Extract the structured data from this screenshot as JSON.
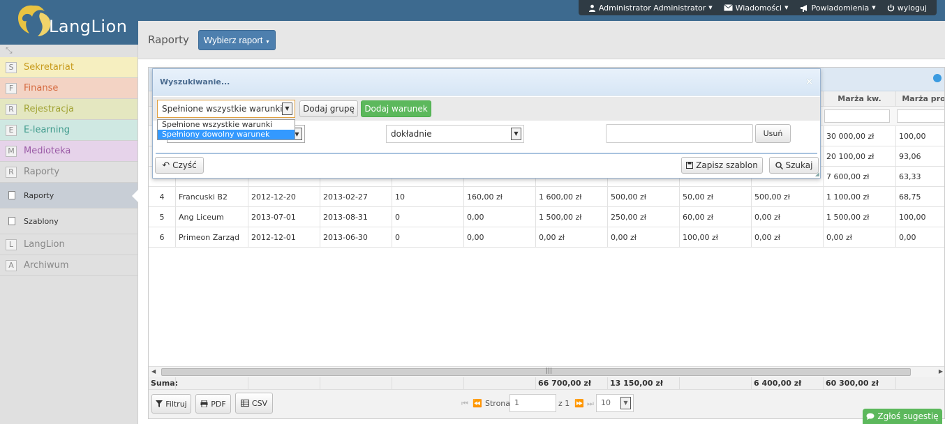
{
  "app": {
    "logo_text": "LangLion"
  },
  "top_menu": [
    {
      "label": "Administrator Administrator",
      "icon": "user-icon",
      "caret": true
    },
    {
      "label": "Wiadomości",
      "icon": "envelope-icon",
      "caret": true
    },
    {
      "label": "Powiadomienia",
      "icon": "megaphone-icon",
      "caret": true
    },
    {
      "label": "wyloguj",
      "icon": "power-icon",
      "caret": false
    }
  ],
  "sidebar": {
    "items": [
      {
        "letter": "S",
        "label": "Sekretariat",
        "color": "#f6efc0",
        "text": "#c79a1b"
      },
      {
        "letter": "F",
        "label": "Finanse",
        "color": "#f3d3c4",
        "text": "#d66c42"
      },
      {
        "letter": "R",
        "label": "Rejestracja",
        "color": "#e4e7c0",
        "text": "#a2a436"
      },
      {
        "letter": "E",
        "label": "E-learning",
        "color": "#cfe8e2",
        "text": "#3f9a8c"
      },
      {
        "letter": "M",
        "label": "Medioteka",
        "color": "#e6d3ea",
        "text": "#9a5aa6"
      },
      {
        "letter": "R",
        "label": "Raporty",
        "color": "#e0e0e0",
        "text": "#888888"
      }
    ],
    "sub_items": [
      {
        "label": "Raporty",
        "active": true
      },
      {
        "label": "Szablony",
        "active": false
      }
    ],
    "bottom_items": [
      {
        "letter": "L",
        "label": "LangLion"
      },
      {
        "letter": "A",
        "label": "Archiwum"
      }
    ]
  },
  "header": {
    "title": "Raporty",
    "select_report_label": "Wybierz raport"
  },
  "table": {
    "headers": [
      "Marża kw.",
      "Marża pro"
    ],
    "rows": [
      {
        "no": "",
        "name": "",
        "start": "",
        "end": "",
        "c5": "",
        "c6": "",
        "c7": "",
        "c8": "",
        "c9": "",
        "c10": "",
        "c11": "30 000,00 zł",
        "c12": "100,00"
      },
      {
        "no": "",
        "name": "",
        "start": "",
        "end": "",
        "c5": "",
        "c6": "",
        "c7": "",
        "c8": "",
        "c9": "",
        "c10": "",
        "c11": "20 100,00 zł",
        "c12": "93,06"
      },
      {
        "no": "",
        "name": "",
        "start": "",
        "end": "",
        "c5": "",
        "c6": "",
        "c7": "",
        "c8": "",
        "c9": "",
        "c10": "",
        "c11": "7 600,00 zł",
        "c12": "63,33"
      },
      {
        "no": "4",
        "name": "Francuski B2",
        "start": "2012-12-20",
        "end": "2013-02-27",
        "c5": "10",
        "c6": "160,00 zł",
        "c7": "1 600,00 zł",
        "c8": "500,00 zł",
        "c9": "50,00 zł",
        "c10": "500,00 zł",
        "c11": "1 100,00 zł",
        "c12": "68,75"
      },
      {
        "no": "5",
        "name": "Ang Liceum",
        "start": "2013-07-01",
        "end": "2013-08-31",
        "c5": "0",
        "c6": "0,00",
        "c7": "1 500,00 zł",
        "c8": "250,00 zł",
        "c9": "60,00 zł",
        "c10": "0,00 zł",
        "c11": "1 500,00 zł",
        "c12": "100,00"
      },
      {
        "no": "6",
        "name": "Primeon Zarząd",
        "start": "2012-12-01",
        "end": "2013-06-30",
        "c5": "0",
        "c6": "0,00",
        "c7": "0,00 zł",
        "c8": "0,00 zł",
        "c9": "100,00 zł",
        "c10": "0,00 zł",
        "c11": "0,00 zł",
        "c12": "0,00"
      }
    ],
    "sum_label": "Suma:",
    "sums": {
      "c7": "66 700,00 zł",
      "c8": "13 150,00 zł",
      "c10": "6 400,00 zł",
      "c11": "60 300,00 zł"
    }
  },
  "footer": {
    "filter_label": "Filtruj",
    "pdf_label": "PDF",
    "csv_label": "CSV",
    "page_label": "Strona",
    "page_value": "1",
    "of_label": "z 1",
    "page_size": "10"
  },
  "dialog": {
    "title": "Wyszukiwanie...",
    "close": "×",
    "match_select_value": "Spełnione wszystkie warunki",
    "match_options": [
      "Spełnione wszystkie warunki",
      "Spełniony dowolny warunek"
    ],
    "match_highlighted_index": 1,
    "add_group_label": "Dodaj grupę",
    "add_condition_label": "Dodaj warunek",
    "operator_value": "dokładnie",
    "remove_label": "Usuń",
    "clear_label": "Czyść",
    "save_template_label": "Zapisz szablon",
    "search_label": "Szukaj"
  },
  "suggest_label": "Zgłoś sugestię",
  "colors": {
    "accent": "#4d7fae",
    "green": "#5cb85c",
    "topbar": "#3d6a8f"
  }
}
